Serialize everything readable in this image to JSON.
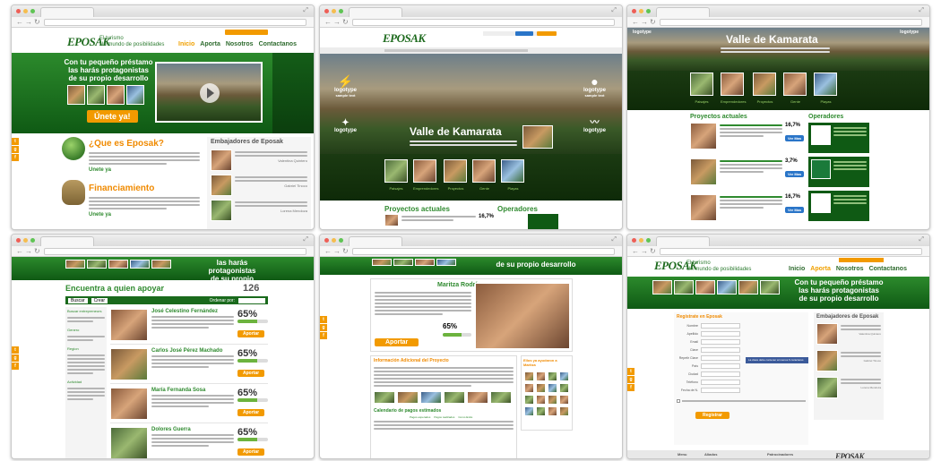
{
  "brand": {
    "logo": "EPOSAK",
    "tagline_1": "El turismo",
    "tagline_2": "Un mundo de posibilidades"
  },
  "colors": {
    "green": "#2c8a2c",
    "dark_green": "#0f5a14",
    "orange": "#f29a00",
    "accent_title": "#f08a00"
  },
  "menu": [
    "Inicio",
    "Aporta",
    "Nosotros",
    "Contactanos"
  ],
  "social_icons": [
    "t",
    "g",
    "f"
  ],
  "home": {
    "hero_text": "Con tu pequeño préstamo las harás protagonistas de su propio desarrollo",
    "cta": "Únete ya!",
    "section1_title": "¿Que es Eposak?",
    "section1_link": "Unete ya",
    "section2_title": "Financiamiento",
    "section2_link": "Unete ya",
    "sidebar_title": "Embajadores de Eposak",
    "ambassadors": [
      "Valentina Quintero",
      "Gabriel Tinoco",
      "Lorena Mendoza"
    ],
    "play_icon": "play-icon"
  },
  "kamarata": {
    "title": "Valle de Kamarata",
    "logos": [
      "logotype",
      "logotype",
      "logotype",
      "logotype"
    ],
    "logo_sub": "sample text",
    "thumb_labels": [
      "Paisajes",
      "Emprendedores",
      "Proyectos",
      "Gente",
      "Playas"
    ],
    "projects_title": "Proyectos actuales",
    "operators_title": "Operadores",
    "project_pcts": [
      "16,7%",
      "3,7%",
      "16,7%"
    ],
    "support_btn": "Ver Mas"
  },
  "listing": {
    "banner_text_1": "las harás protagonistas",
    "banner_text_2": "de su propio desarrollo",
    "search_title": "Encuentra a quien apoyar",
    "count": "126",
    "filters": [
      "Buscar",
      "Crear"
    ],
    "sort_label": "Ordenar por:",
    "filter_groups": [
      "Buscar entrepreneurs",
      "Genero",
      "Region",
      "Actividad"
    ],
    "people": [
      {
        "name": "José Celestino Fernández",
        "pct": "65%",
        "btn": "Aportar"
      },
      {
        "name": "Carlos José Pérez Machado",
        "pct": "65%",
        "btn": "Aportar"
      },
      {
        "name": "María Fernanda Sosa",
        "pct": "65%",
        "btn": "Aportar"
      },
      {
        "name": "Dolores Guerra",
        "pct": "65%",
        "btn": "Aportar"
      }
    ],
    "progress": 0.65
  },
  "profile": {
    "banner_text": "de su propio desarrollo",
    "name": "Maritza Rodríguez",
    "cta": "Aportar",
    "pct": "65%",
    "info_title": "Información Adicional del Proyecto",
    "friends_title": "Ellos ya ayudaron a Maritza",
    "table_title": "Calendario de pagos estimados",
    "table_headers": [
      "Pagos esperados",
      "Pagos realizados",
      "Como Extra"
    ],
    "progress": 0.65
  },
  "register": {
    "hero_text": "Con tu pequeño préstamo las harás protagonistas de su propio desarrollo",
    "form_title": "Regístrate en Eposak",
    "fields": [
      "Nombre",
      "Apellido",
      "Email",
      "Clave",
      "Repetir Clave",
      "País",
      "Ciudad",
      "Teléfono",
      "Fecha de N."
    ],
    "submit": "Registrar",
    "tooltip": "La clave debe contener al menos 6 caracteres",
    "sidebar_title": "Embajadores de Eposak",
    "ambassadors": [
      "Valentina Quintero",
      "Gabriel Tinoco",
      "Lorena Mendoza"
    ],
    "footer_cols": [
      "Menu",
      "Aliados",
      "Patrocinadores"
    ]
  }
}
